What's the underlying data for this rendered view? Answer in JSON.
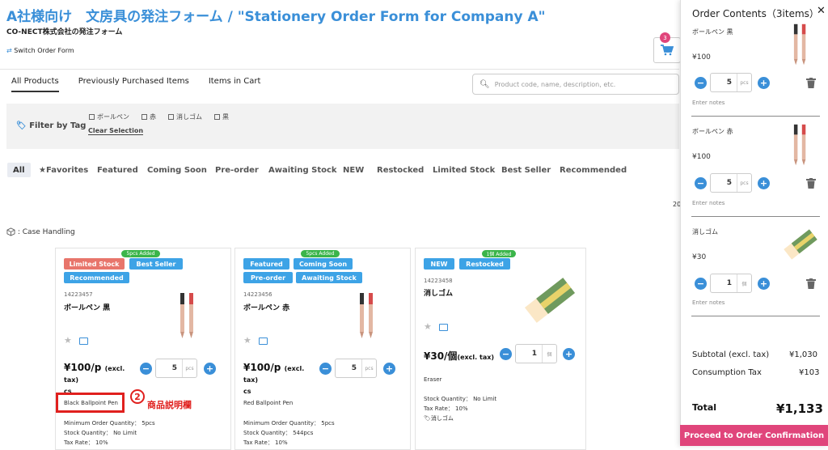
{
  "header": {
    "title": "A社様向け　文房具の発注フォーム / \"Stationery Order Form for Company A\"",
    "subtitle": "CO-NECT株式会社の発注フォーム",
    "switch_label": "Switch Order Form",
    "cart_count": "3"
  },
  "tabs": [
    "All Products",
    "Previously Purchased Items",
    "Items in Cart"
  ],
  "search": {
    "placeholder": "Product code, name, description, etc."
  },
  "filter": {
    "label": "Filter by Tag",
    "options": [
      "ボールペン",
      "赤",
      "消しゴム",
      "黒"
    ],
    "clear_label": "Clear Selection"
  },
  "categories": [
    "All",
    "★Favorites",
    "Featured",
    "Coming Soon",
    "Pre-order",
    "Awaiting Stock",
    "NEW",
    "Restocked",
    "Limited Stock",
    "Best Seller",
    "Recommended"
  ],
  "count_label": "20",
  "case_handling": ": Case Handling",
  "products": [
    {
      "added": "5pcs Added",
      "tags": [
        "Limited Stock",
        "Best Seller",
        "Recommended"
      ],
      "code": "14223457",
      "name": "ボールペン 黒",
      "price": "¥100/p",
      "price_unit": "(excl. tax)",
      "price_suffix": "cs",
      "qty": "5",
      "unit": "pcs",
      "desc": "Black Ballpoint Pen",
      "min_order": "Minimum Order Quantity： 5pcs",
      "stock": "Stock Quantity： No Limit",
      "tax": "Tax Rate： 10%"
    },
    {
      "added": "5pcs Added",
      "tags": [
        "Featured",
        "Coming Soon",
        "Pre-order",
        "Awaiting Stock"
      ],
      "code": "14223456",
      "name": "ボールペン 赤",
      "price": "¥100/p",
      "price_unit": "(excl. tax)",
      "price_suffix": "cs",
      "qty": "5",
      "unit": "pcs",
      "desc": "Red Ballpoint Pen",
      "min_order": "Minimum Order Quantity： 5pcs",
      "stock": "Stock Quantity： 544pcs",
      "tax": "Tax Rate： 10%"
    },
    {
      "added": "1個 Added",
      "tags": [
        "NEW",
        "Restocked"
      ],
      "code": "14223458",
      "name": "消しゴム",
      "price": "¥30/個",
      "price_unit": "(excl. tax)",
      "qty": "1",
      "unit": "個",
      "desc": "Eraser",
      "stock": "Stock Quantity： No Limit",
      "tax": "Tax Rate： 10%",
      "tag_label": "消しゴム"
    }
  ],
  "annotation": {
    "number": "2",
    "label": "商品説明欄"
  },
  "order_panel": {
    "title": "Order Contents（3items）",
    "items": [
      {
        "name": "ボールペン 黒",
        "price": "¥100",
        "qty": "5",
        "unit": "pcs",
        "notes": "Enter notes"
      },
      {
        "name": "ボールペン 赤",
        "price": "¥100",
        "qty": "5",
        "unit": "pcs",
        "notes": "Enter notes"
      },
      {
        "name": "消しゴム",
        "price": "¥30",
        "qty": "1",
        "unit": "個",
        "notes": "Enter notes"
      }
    ],
    "subtotal_label": "Subtotal (excl. tax)",
    "subtotal_value": "¥1,030",
    "tax_label": "Consumption Tax",
    "tax_value": "¥103",
    "total_label": "Total",
    "total_value": "¥1,133",
    "proceed_label": "Proceed to Order Confirmation"
  },
  "colors": {
    "accent": "#3a8fd8",
    "proceed": "#e0457b",
    "tag_red": "#e8756b",
    "tag_blue": "#3da3e6",
    "added_green": "#3bb54a",
    "annotation_red": "#e0201e"
  }
}
